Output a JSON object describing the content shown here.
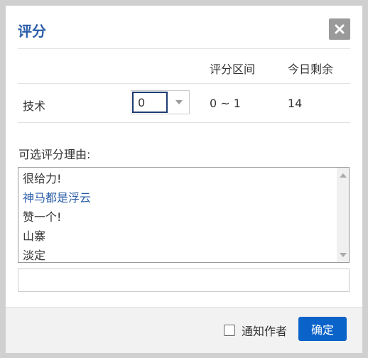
{
  "dialog": {
    "title": "评分",
    "close_icon": "close-icon"
  },
  "table": {
    "headers": {
      "range": "评分区间",
      "remaining": "今日剩余"
    },
    "row": {
      "label": "技术",
      "score_value": "0",
      "range": "0 ~ 1",
      "remaining": "14"
    }
  },
  "reasons": {
    "label": "可选评分理由:",
    "items": [
      "很给力!",
      "神马都是浮云",
      "赞一个!",
      "山寨",
      "淡定"
    ],
    "selected_index": 1,
    "custom_value": ""
  },
  "footer": {
    "notify_label": "通知作者",
    "notify_checked": false,
    "confirm_label": "确定"
  },
  "colors": {
    "title": "#2a5da8",
    "selected_reason": "#2a5da8",
    "confirm_button": "#0a63c9",
    "close_button": "#9a9a9a"
  }
}
